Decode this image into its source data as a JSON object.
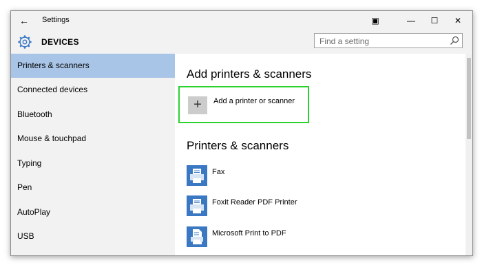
{
  "window": {
    "title": "Settings",
    "controls": {
      "snap": "▣",
      "minimize": "—",
      "maximize": "☐",
      "close": "✕"
    }
  },
  "header": {
    "section": "DEVICES",
    "search_placeholder": "Find a setting"
  },
  "sidebar": {
    "items": [
      {
        "label": "Printers & scanners",
        "selected": true
      },
      {
        "label": "Connected devices"
      },
      {
        "label": "Bluetooth"
      },
      {
        "label": "Mouse & touchpad"
      },
      {
        "label": "Typing"
      },
      {
        "label": "Pen"
      },
      {
        "label": "AutoPlay"
      },
      {
        "label": "USB"
      }
    ]
  },
  "main": {
    "add_section_title": "Add printers & scanners",
    "add_button_label": "Add a printer or scanner",
    "list_title": "Printers & scanners",
    "printers": [
      {
        "name": "Fax",
        "icon": "printer-icon"
      },
      {
        "name": "Foxit Reader PDF Printer",
        "icon": "printer-icon"
      },
      {
        "name": "Microsoft Print to PDF",
        "icon": "pdf-printer-icon"
      }
    ]
  },
  "colors": {
    "accent": "#3b78c4",
    "selected_nav": "#a8c4e6",
    "highlight_box": "#2bd22b"
  }
}
